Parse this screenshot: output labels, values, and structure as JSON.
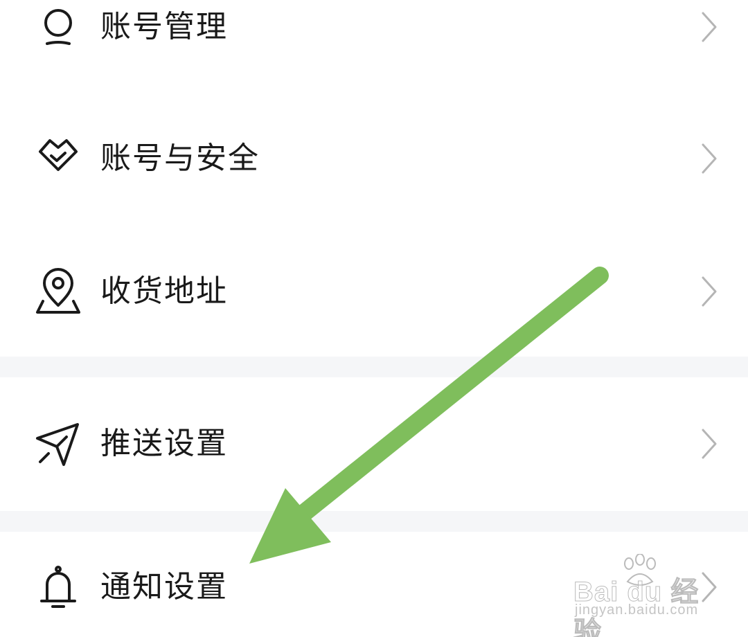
{
  "settings": {
    "items": [
      {
        "label": "账号管理",
        "icon": "user-icon"
      },
      {
        "label": "账号与安全",
        "icon": "shield-check-icon"
      },
      {
        "label": "收货地址",
        "icon": "location-pin-icon"
      },
      {
        "label": "推送设置",
        "icon": "send-icon"
      },
      {
        "label": "通知设置",
        "icon": "bell-icon"
      }
    ]
  },
  "watermark": {
    "brand": "Bai du 经验",
    "url": "jingyan.baidu.com"
  },
  "colors": {
    "text": "#1a1a1a",
    "chevron": "#b5b5b5",
    "divider": "#f5f6f8",
    "annotation_arrow": "#7fbe5c"
  }
}
